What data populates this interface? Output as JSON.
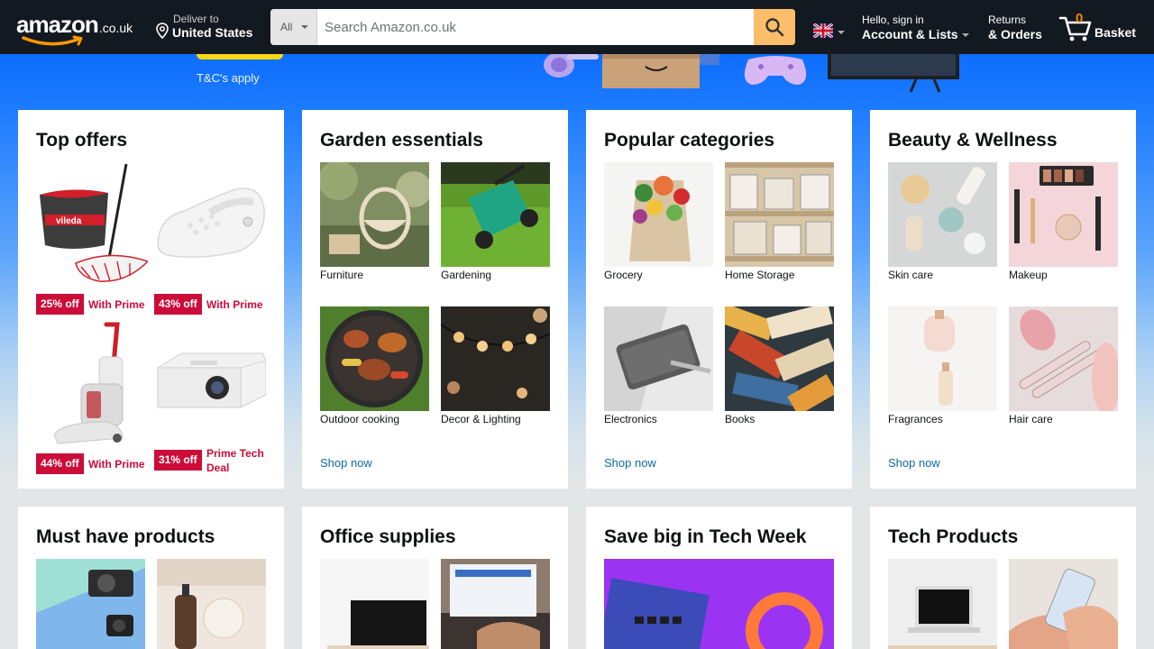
{
  "nav": {
    "logo_text": "amazon",
    "logo_tld": ".co.uk",
    "deliver_line1": "Deliver to",
    "deliver_line2": "United States",
    "search_category": "All",
    "search_placeholder": "Search Amazon.co.uk",
    "account_line1": "Hello, sign in",
    "account_line2": "Account & Lists",
    "orders_line1": "Returns",
    "orders_line2": "& Orders",
    "basket_count": "0",
    "basket_label": "Basket",
    "colors": {
      "bar": "#131921",
      "search_button": "#febd69",
      "count": "#f08804"
    }
  },
  "hero": {
    "terms": "T&C's apply"
  },
  "cards": {
    "top_offers": {
      "title": "Top offers",
      "offers": [
        {
          "discount": "25% off",
          "deal": "With Prime",
          "image": "spin-mop-icon"
        },
        {
          "discount": "43% off",
          "deal": "With Prime",
          "image": "clog-icon"
        },
        {
          "discount": "44% off",
          "deal": "With Prime",
          "image": "carpet-cleaner-icon"
        },
        {
          "discount": "31% off",
          "deal": "Prime Tech Deal",
          "image": "projector-icon"
        }
      ]
    },
    "garden": {
      "title": "Garden essentials",
      "tiles": [
        "Furniture",
        "Gardening",
        "Outdoor cooking",
        "Decor & Lighting"
      ],
      "link": "Shop now"
    },
    "popular": {
      "title": "Popular categories",
      "tiles": [
        "Grocery",
        "Home Storage",
        "Electronics",
        "Books"
      ],
      "link": "Shop now"
    },
    "beauty": {
      "title": "Beauty & Wellness",
      "tiles": [
        "Skin care",
        "Makeup",
        "Fragrances",
        "Hair care"
      ],
      "link": "Shop now"
    },
    "must_have": {
      "title": "Must have products"
    },
    "office": {
      "title": "Office supplies"
    },
    "tech_week": {
      "title": "Save big in Tech Week"
    },
    "tech_products": {
      "title": "Tech Products"
    }
  },
  "colors": {
    "deal_red": "#cc0c39",
    "link_blue": "#0f6aa6",
    "hero_blue": "#0d6efd"
  }
}
